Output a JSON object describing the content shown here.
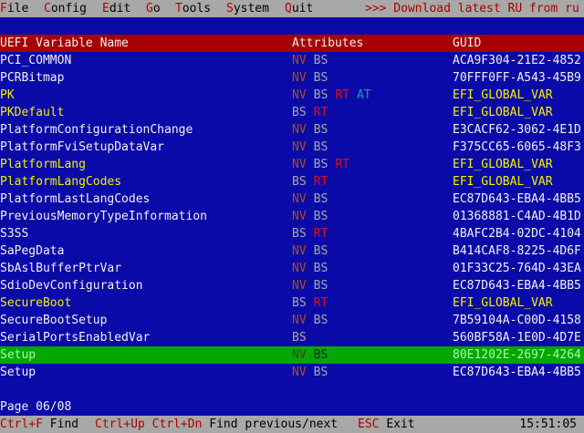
{
  "menu": [
    {
      "hot": "F",
      "rest": "ile"
    },
    {
      "hot": "C",
      "rest": "onfig"
    },
    {
      "hot": "E",
      "rest": "dit"
    },
    {
      "hot": "G",
      "rest": "o"
    },
    {
      "hot": "T",
      "rest": "ools"
    },
    {
      "hot": "S",
      "rest": "ystem"
    },
    {
      "hot": "Q",
      "rest": "uit"
    }
  ],
  "ticker": ">>> Download latest RU from ru",
  "table": {
    "headers": {
      "name": "UEFI Variable Name",
      "attributes": "Attributes",
      "guid": "GUID"
    },
    "rows": [
      {
        "name": "PCI_COMMON",
        "attrs": [
          "NV",
          "BS"
        ],
        "guid": "ACA9F304-21E2-4852",
        "highlight": false
      },
      {
        "name": "PCRBitmap",
        "attrs": [
          "NV",
          "BS"
        ],
        "guid": "70FFF0FF-A543-45B9",
        "highlight": false
      },
      {
        "name": "PK",
        "attrs": [
          "NV",
          "BS",
          "RT",
          "AT"
        ],
        "guid": "EFI_GLOBAL_VAR",
        "highlight": true
      },
      {
        "name": "PKDefault",
        "attrs": [
          "BS",
          "RT"
        ],
        "guid": "EFI_GLOBAL_VAR",
        "highlight": true
      },
      {
        "name": "PlatformConfigurationChange",
        "attrs": [
          "NV",
          "BS"
        ],
        "guid": "E3CACF62-3062-4E1D",
        "highlight": false
      },
      {
        "name": "PlatformFviSetupDataVar",
        "attrs": [
          "NV",
          "BS"
        ],
        "guid": "F375CC65-6065-48F3",
        "highlight": false
      },
      {
        "name": "PlatformLang",
        "attrs": [
          "NV",
          "BS",
          "RT"
        ],
        "guid": "EFI_GLOBAL_VAR",
        "highlight": true
      },
      {
        "name": "PlatformLangCodes",
        "attrs": [
          "BS",
          "RT"
        ],
        "guid": "EFI_GLOBAL_VAR",
        "highlight": true
      },
      {
        "name": "PlatformLastLangCodes",
        "attrs": [
          "NV",
          "BS"
        ],
        "guid": "EC87D643-EBA4-4BB5",
        "highlight": false
      },
      {
        "name": "PreviousMemoryTypeInformation",
        "attrs": [
          "NV",
          "BS"
        ],
        "guid": "01368881-C4AD-4B1D",
        "highlight": false
      },
      {
        "name": "S3SS",
        "attrs": [
          "BS",
          "RT"
        ],
        "guid": "4BAFC2B4-02DC-4104",
        "highlight": false
      },
      {
        "name": "SaPegData",
        "attrs": [
          "NV",
          "BS"
        ],
        "guid": "B414CAF8-8225-4D6F",
        "highlight": false
      },
      {
        "name": "SbAslBufferPtrVar",
        "attrs": [
          "NV",
          "BS"
        ],
        "guid": "01F33C25-764D-43EA",
        "highlight": false
      },
      {
        "name": "SdioDevConfiguration",
        "attrs": [
          "NV",
          "BS"
        ],
        "guid": "EC87D643-EBA4-4BB5",
        "highlight": false
      },
      {
        "name": "SecureBoot",
        "attrs": [
          "BS",
          "RT"
        ],
        "guid": "EFI_GLOBAL_VAR",
        "highlight": true
      },
      {
        "name": "SecureBootSetup",
        "attrs": [
          "NV",
          "BS"
        ],
        "guid": "7B59104A-C00D-4158",
        "highlight": false
      },
      {
        "name": "SerialPortsEnabledVar",
        "attrs": [
          "BS"
        ],
        "guid": "560BF58A-1E0D-4D7E",
        "highlight": false
      },
      {
        "name": "Setup",
        "attrs": [
          "NV",
          "BS"
        ],
        "guid": "80E1202E-2697-4264",
        "highlight": false,
        "selected": true
      },
      {
        "name": "Setup",
        "attrs": [
          "NV",
          "BS"
        ],
        "guid": "EC87D643-EBA4-4BB5",
        "highlight": false
      }
    ]
  },
  "page": "Page 06/08",
  "status": {
    "find_key": "Ctrl+F",
    "find_label": "Find",
    "prev_key": "Ctrl+Up",
    "next_key": "Ctrl+Dn",
    "prevnext_label": "Find previous/next",
    "exit_key": "ESC",
    "exit_label": "Exit",
    "clock": "15:51:05"
  }
}
